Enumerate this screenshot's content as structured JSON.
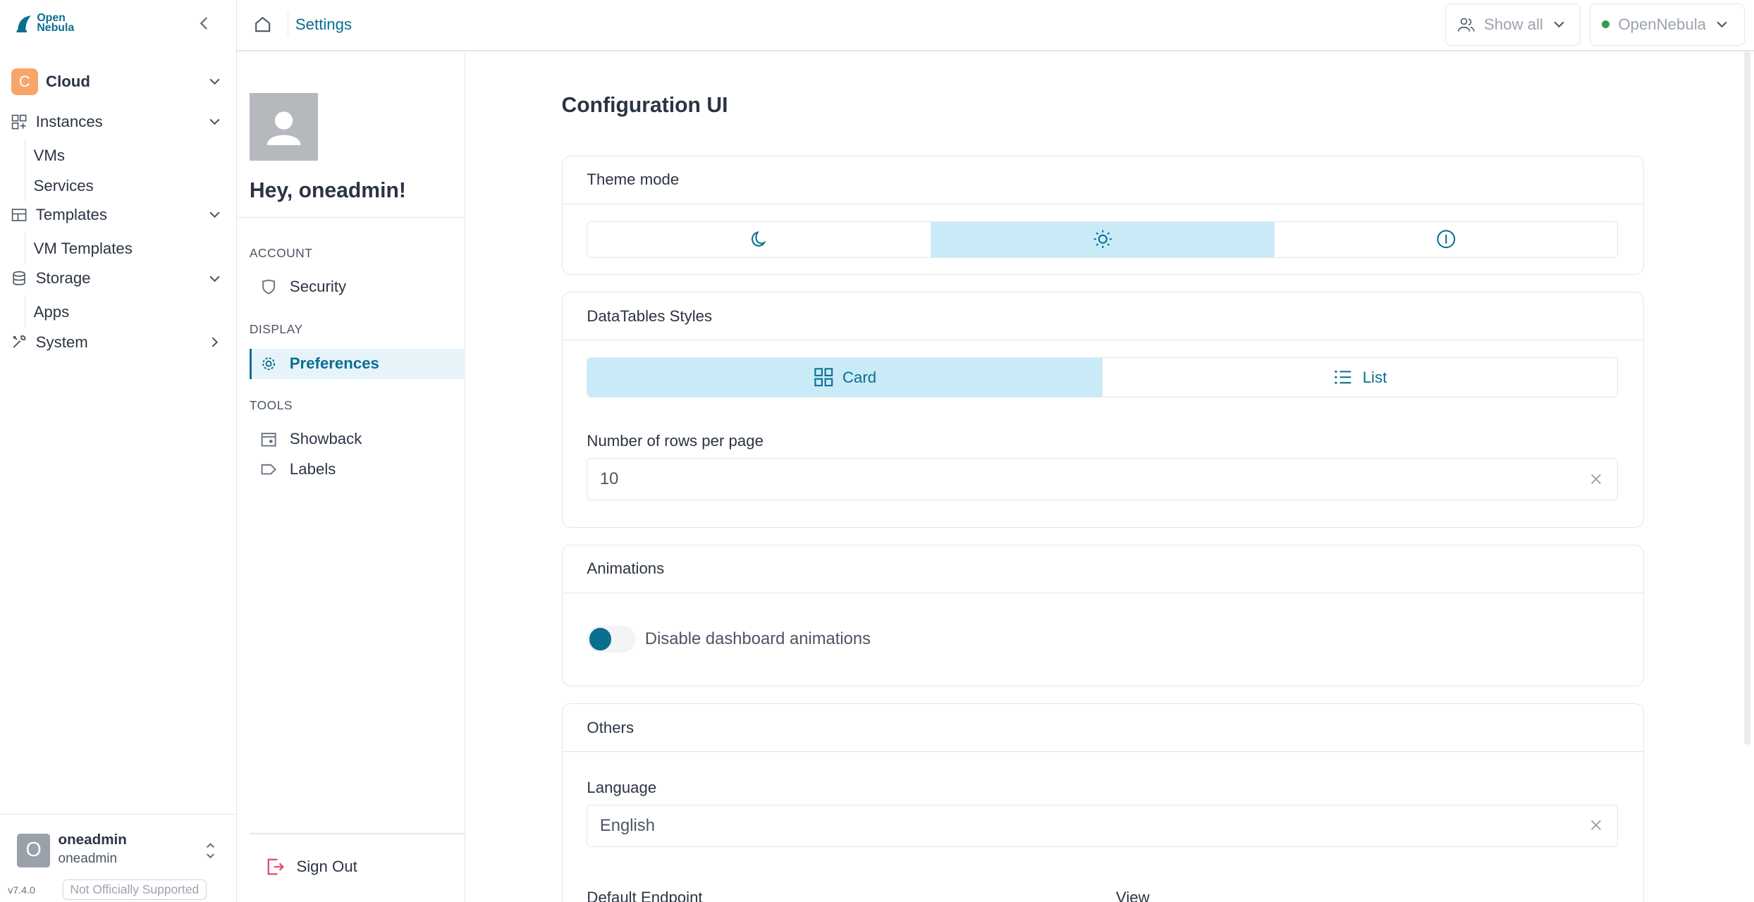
{
  "sidebar": {
    "logo_line1": "Open",
    "logo_line2": "Nebula",
    "cloud": {
      "badge": "C",
      "label": "Cloud"
    },
    "groups": [
      {
        "label": "Instances",
        "items": [
          "VMs",
          "Services"
        ]
      },
      {
        "label": "Templates",
        "items": [
          "VM Templates"
        ]
      },
      {
        "label": "Storage",
        "items": [
          "Apps"
        ]
      },
      {
        "label": "System",
        "items": []
      }
    ],
    "user": {
      "avatar_letter": "O",
      "name": "oneadmin",
      "group": "oneadmin"
    },
    "version": "v7.4.0",
    "support_badge": "Not Officially Supported"
  },
  "header": {
    "breadcrumb": "Settings",
    "filter_label": "Show all",
    "zone_label": "OpenNebula",
    "zone_status_color": "#2e9e4e"
  },
  "settings": {
    "greeting": "Hey, oneadmin!",
    "sections": [
      {
        "title": "ACCOUNT",
        "items": [
          {
            "label": "Security",
            "icon": "shield-icon"
          }
        ]
      },
      {
        "title": "DISPLAY",
        "items": [
          {
            "label": "Preferences",
            "icon": "gear-icon",
            "active": true
          }
        ]
      },
      {
        "title": "TOOLS",
        "items": [
          {
            "label": "Showback",
            "icon": "calendar-icon"
          },
          {
            "label": "Labels",
            "icon": "tag-icon"
          }
        ]
      }
    ],
    "sign_out": "Sign Out"
  },
  "main": {
    "title": "Configuration UI",
    "theme": {
      "title": "Theme mode",
      "options": [
        "dark-moon-icon",
        "light-sun-icon",
        "system-info-icon"
      ],
      "selected": 1
    },
    "datatables": {
      "title": "DataTables Styles",
      "options": [
        {
          "label": "Card",
          "icon": "grid-icon"
        },
        {
          "label": "List",
          "icon": "list-icon"
        }
      ],
      "selected": 0,
      "rows_label": "Number of rows per page",
      "rows_value": "10"
    },
    "animations": {
      "title": "Animations",
      "toggle_label": "Disable dashboard animations",
      "enabled": true
    },
    "others": {
      "title": "Others",
      "language_label": "Language",
      "language_value": "English",
      "default_endpoint_label": "Default Endpoint",
      "view_label": "View"
    }
  },
  "colors": {
    "accent": "#0a6e8f",
    "selected_bg": "#c9ebf8",
    "active_menu_bg": "#e6f4fa",
    "cloud_badge": "#f7a56a",
    "signout": "#e04a6a"
  }
}
